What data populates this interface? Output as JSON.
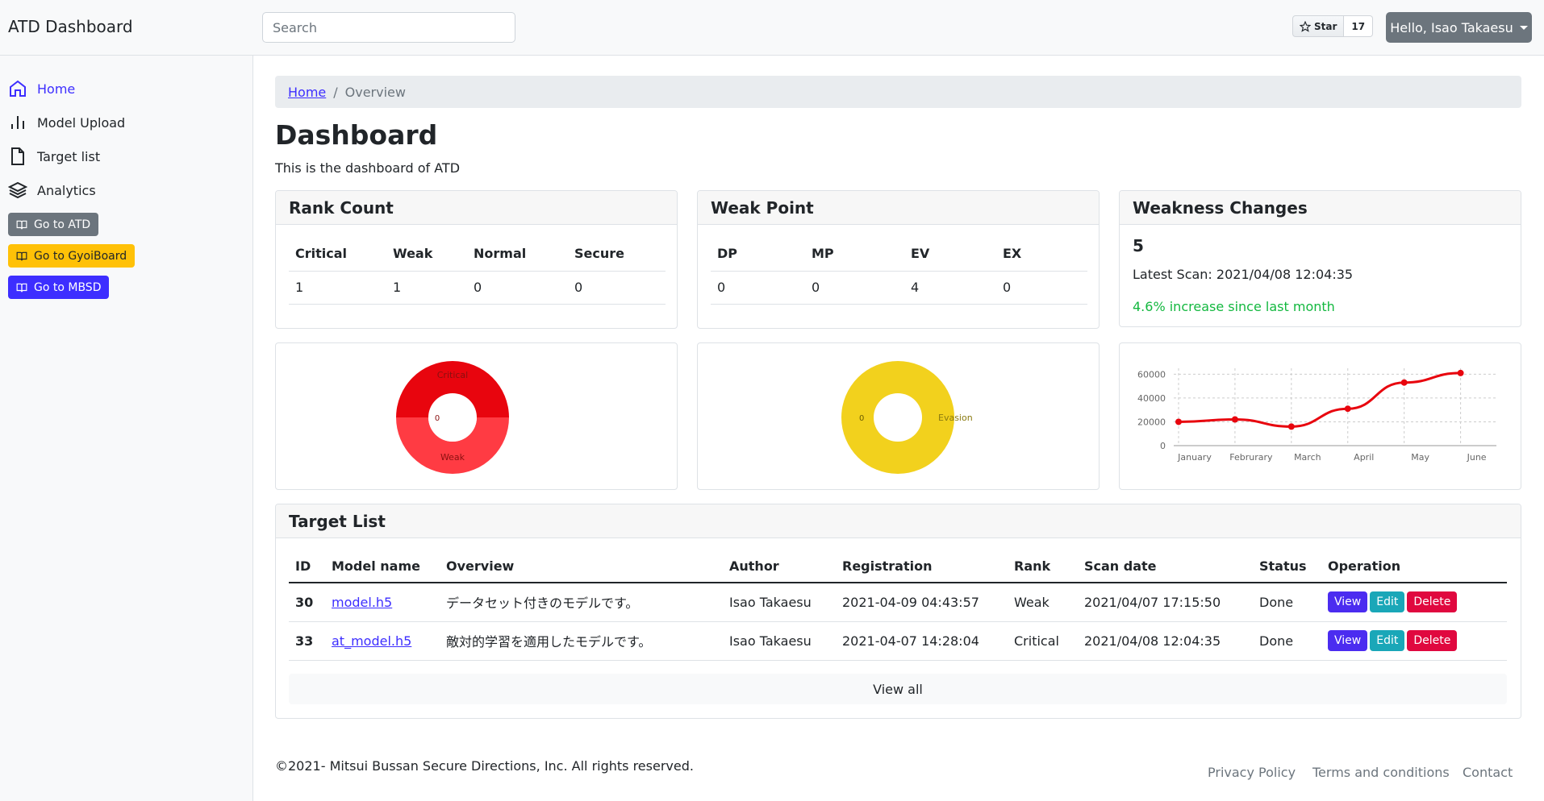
{
  "app": {
    "title": "ATD Dashboard"
  },
  "search": {
    "placeholder": "Search"
  },
  "github": {
    "star_label": "Star",
    "star_count": "17",
    "icon": "star-icon"
  },
  "user_menu": {
    "label": "Hello, Isao Takaesu"
  },
  "sidebar": {
    "items": [
      {
        "label": "Home",
        "icon": "home-icon",
        "active": true
      },
      {
        "label": "Model Upload",
        "icon": "bar-chart-icon",
        "active": false
      },
      {
        "label": "Target list",
        "icon": "file-icon",
        "active": false
      },
      {
        "label": "Analytics",
        "icon": "layers-icon",
        "active": false
      }
    ],
    "buttons": [
      {
        "label": "Go to ATD",
        "icon": "book-icon",
        "color": "#6c757d"
      },
      {
        "label": "Go to GyoiBoard",
        "icon": "book-icon",
        "color": "#ffc107"
      },
      {
        "label": "Go to MBSD",
        "icon": "book-icon",
        "color": "#3d2eff"
      }
    ]
  },
  "breadcrumb": {
    "home": "Home",
    "current": "Overview"
  },
  "page": {
    "title": "Dashboard",
    "subtitle": "This is the dashboard of ATD"
  },
  "rank_count": {
    "title": "Rank Count",
    "columns": [
      "Critical",
      "Weak",
      "Normal",
      "Secure"
    ],
    "values": [
      "1",
      "1",
      "0",
      "0"
    ]
  },
  "weak_point": {
    "title": "Weak Point",
    "columns": [
      "DP",
      "MP",
      "EV",
      "EX"
    ],
    "values": [
      "0",
      "0",
      "4",
      "0"
    ]
  },
  "weakness_changes": {
    "title": "Weakness Changes",
    "number": "5",
    "latest_scan": "Latest Scan: 2021/04/08 12:04:35",
    "increase": "4.6% increase since last month"
  },
  "rank_donut": {
    "labels": {
      "critical": "Critical",
      "weak": "Weak",
      "zero": "0"
    },
    "colors": {
      "critical": "#e8050e",
      "weak": "#ff3b43"
    }
  },
  "weak_donut": {
    "labels": {
      "evasion": "Evasion",
      "zero": "0"
    },
    "colors": {
      "evasion": "#f2d11d"
    }
  },
  "chart_data": {
    "type": "line",
    "categories": [
      "January",
      "Februrary",
      "March",
      "April",
      "May",
      "June"
    ],
    "values": [
      20000,
      22000,
      16000,
      31000,
      53000,
      61000
    ],
    "yticks": [
      0,
      20000,
      40000,
      60000
    ],
    "ylim": [
      0,
      65000
    ],
    "color": "#e8050e",
    "grid": true
  },
  "target_list": {
    "title": "Target List",
    "columns": [
      "ID",
      "Model name",
      "Overview",
      "Author",
      "Registration",
      "Rank",
      "Scan date",
      "Status",
      "Operation"
    ],
    "rows": [
      {
        "id": "30",
        "model": "model.h5",
        "overview": "データセット付きのモデルです。",
        "author": "Isao Takaesu",
        "registration": "2021-04-09 04:43:57",
        "rank": "Weak",
        "scan_date": "2021/04/07 17:15:50",
        "status": "Done"
      },
      {
        "id": "33",
        "model": "at_model.h5",
        "overview": "敵対的学習を適用したモデルです。",
        "author": "Isao Takaesu",
        "registration": "2021-04-07 14:28:04",
        "rank": "Critical",
        "scan_date": "2021/04/08 12:04:35",
        "status": "Done"
      }
    ],
    "operations": {
      "view": "View",
      "edit": "Edit",
      "delete": "Delete"
    },
    "view_all": "View all"
  },
  "footer": {
    "copyright": "©2021- Mitsui Bussan Secure Directions, Inc. All rights reserved.",
    "links": [
      "Privacy Policy",
      "Terms and conditions",
      "Contact"
    ]
  }
}
